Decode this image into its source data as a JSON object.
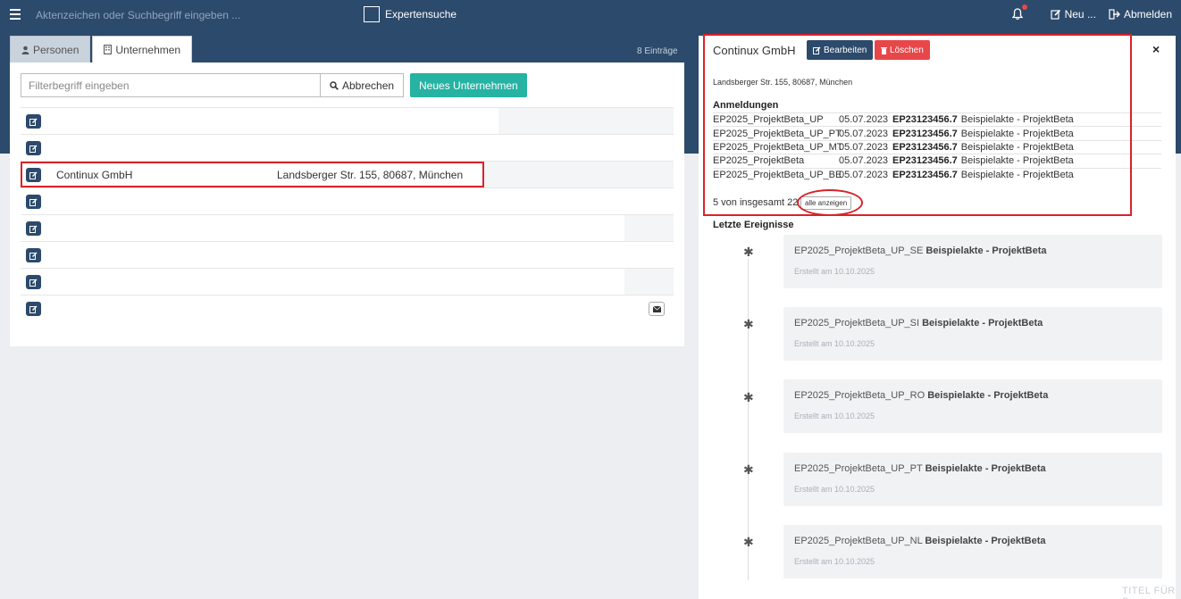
{
  "topbar": {
    "search_placeholder": "Aktenzeichen oder Suchbegriff eingeben ...",
    "expert_label": "Expertensuche",
    "new_label": "Neu ...",
    "logout_label": "Abmelden"
  },
  "tabs": [
    {
      "label": "Personen"
    },
    {
      "label": "Unternehmen"
    }
  ],
  "entry_count": "8 Einträge",
  "filter": {
    "placeholder": "Filterbegriff eingeben",
    "cancel_label": "Abbrechen",
    "new_company_label": "Neues Unternehmen"
  },
  "rows": [
    {
      "name": "",
      "address": ""
    },
    {
      "name": "",
      "address": ""
    },
    {
      "name": "Continux GmbH",
      "address": "Landsberger Str. 155, 80687, München"
    },
    {
      "name": "",
      "address": ""
    },
    {
      "name": "",
      "address": ""
    },
    {
      "name": "",
      "address": ""
    },
    {
      "name": "",
      "address": ""
    },
    {
      "name": "",
      "address": ""
    }
  ],
  "detail": {
    "title": "Continux GmbH",
    "edit_label": "Bearbeiten",
    "delete_label": "Löschen",
    "close_symbol": "×",
    "address": "Landsberger Str. 155, 80687, München",
    "registrations_heading": "Anmeldungen",
    "registrations": [
      {
        "code": "EP2025_ProjektBeta_UP",
        "date": "05.07.2023",
        "ref": "EP23123456.7",
        "desc": "Beispielakte - ProjektBeta"
      },
      {
        "code": "EP2025_ProjektBeta_UP_PT",
        "date": "05.07.2023",
        "ref": "EP23123456.7",
        "desc": "Beispielakte - ProjektBeta"
      },
      {
        "code": "EP2025_ProjektBeta_UP_MT",
        "date": "05.07.2023",
        "ref": "EP23123456.7",
        "desc": "Beispielakte - ProjektBeta"
      },
      {
        "code": "EP2025_ProjektBeta",
        "date": "05.07.2023",
        "ref": "EP23123456.7",
        "desc": "Beispielakte - ProjektBeta"
      },
      {
        "code": "EP2025_ProjektBeta_UP_BE",
        "date": "05.07.2023",
        "ref": "EP23123456.7",
        "desc": "Beispielakte - ProjektBeta"
      }
    ],
    "more_text": "5 von insgesamt 22",
    "show_all_label": "alle anzeigen",
    "events_heading": "Letzte Ereignisse",
    "events": [
      {
        "code": "EP2025_ProjektBeta_UP_SE",
        "title": "Beispielakte - ProjektBeta",
        "created": "Erstellt am 10.10.2025"
      },
      {
        "code": "EP2025_ProjektBeta_UP_SI",
        "title": "Beispielakte - ProjektBeta",
        "created": "Erstellt am 10.10.2025"
      },
      {
        "code": "EP2025_ProjektBeta_UP_RO",
        "title": "Beispielakte - ProjektBeta",
        "created": "Erstellt am 10.10.2025"
      },
      {
        "code": "EP2025_ProjektBeta_UP_PT",
        "title": "Beispielakte - ProjektBeta",
        "created": "Erstellt am 10.10.2025"
      },
      {
        "code": "EP2025_ProjektBeta_UP_NL",
        "title": "Beispielakte - ProjektBeta",
        "created": "Erstellt am 10.10.2025"
      }
    ]
  },
  "footer_ghost": "TITEL FÜR S",
  "colors": {
    "primary": "#2c4a6b",
    "accent_teal": "#26b3a3",
    "danger": "#e8474a",
    "highlight": "#d9222a"
  }
}
